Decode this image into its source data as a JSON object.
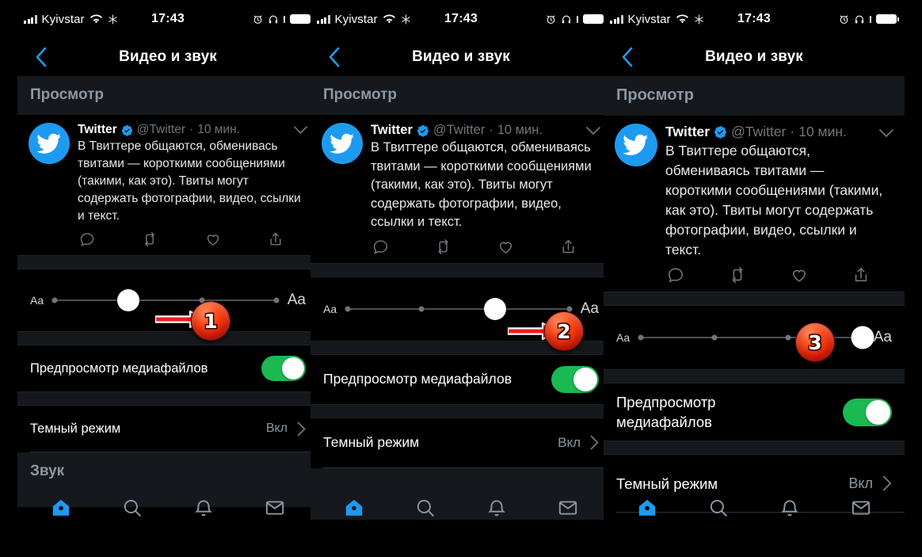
{
  "meta": {
    "accent_blue": "#1d9bf0",
    "toggle_green": "#1ab952",
    "marker_red": "#e8230a",
    "section_bg": "#15181c",
    "muted_text": "#71767b"
  },
  "status_bar": {
    "carrier": "Kyivstar",
    "time": "17:43",
    "icons_left": [
      "signal-bars-icon",
      "wifi-icon",
      "snowflake-icon"
    ],
    "icons_right": [
      "alarm-icon",
      "headphones-icon",
      "battery-stub-icon",
      "battery-icon"
    ]
  },
  "nav": {
    "back_icon": "chevron-left-icon",
    "title": "Видео и звук"
  },
  "section": {
    "preview_header": "Просмотр",
    "sound_header": "Звук"
  },
  "tweet": {
    "avatar_icon": "twitter-bird-icon",
    "name": "Twitter",
    "verified_icon": "verified-badge-icon",
    "handle": "@Twitter",
    "separator": "·",
    "time": "10 мин.",
    "caret_icon": "chevron-down-icon",
    "text_small": "В Твиттере общаются, обменивась твитами — короткими сообщениями (такими, как это). Твиты могут содержать фотографии, видео, ссылки и текст.",
    "text": "В Твиттере общаются, обмениваясь твитами — короткими сообщениями (такими, как это). Твиты могут содержать фотографии, видео, ссылки и текст.",
    "actions": [
      "reply-icon",
      "retweet-icon",
      "like-icon",
      "share-icon"
    ]
  },
  "slider": {
    "label_small": "Aa",
    "label_large": "Aa",
    "ticks": 4,
    "panel1_value_percent": 38,
    "panel2_value_percent": 66,
    "panel3_value_percent": 100
  },
  "rows": {
    "media_preview_label": "Предпросмотр медиафайлов",
    "media_preview_state": "on",
    "dark_mode_label": "Темный режим",
    "dark_mode_value": "Вкл",
    "chevron_icon": "chevron-right-icon"
  },
  "tabbar": {
    "items": [
      {
        "name": "home-tab",
        "icon": "home-icon",
        "active": true
      },
      {
        "name": "search-tab",
        "icon": "search-icon",
        "active": false
      },
      {
        "name": "notifications-tab",
        "icon": "bell-icon",
        "active": false
      },
      {
        "name": "messages-tab",
        "icon": "envelope-icon",
        "active": false
      }
    ]
  },
  "markers": {
    "step1": "1",
    "step2": "2",
    "step3": "3"
  }
}
